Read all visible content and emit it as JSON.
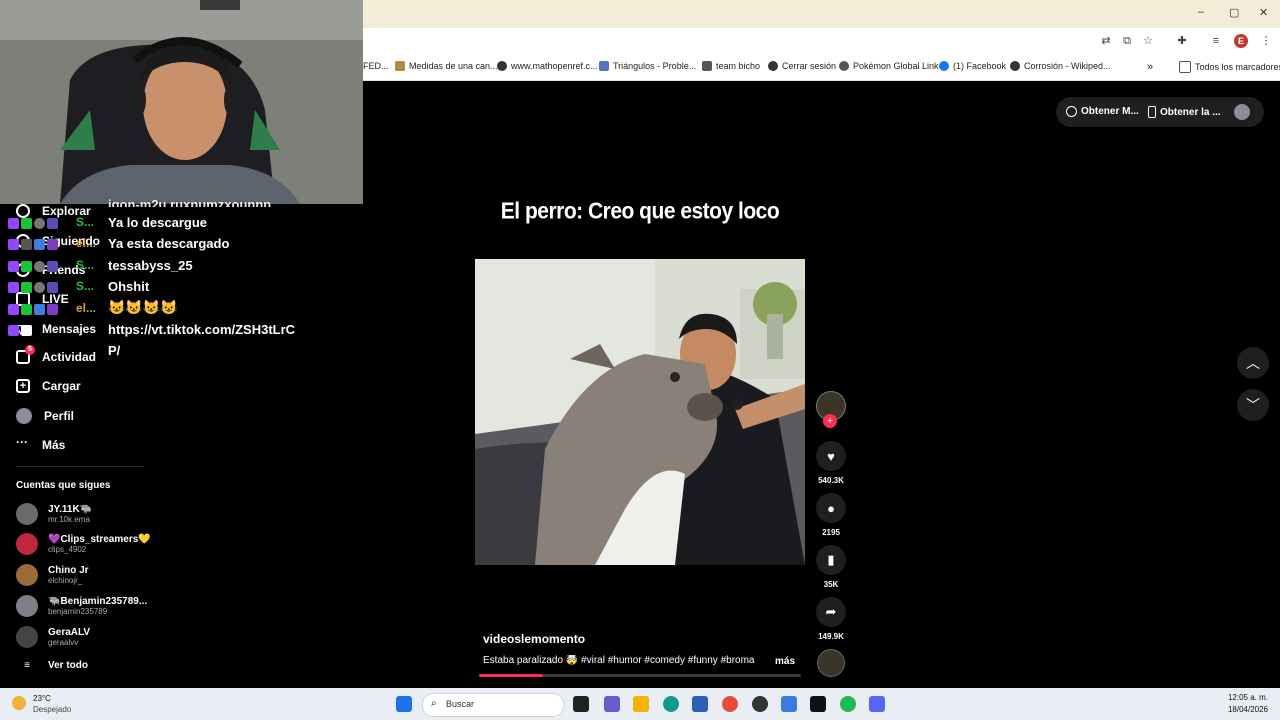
{
  "browser": {
    "window_controls": {
      "minimize": "–",
      "maximize": "▢",
      "close": "✕"
    },
    "profile_initial": "E",
    "bookmarks": [
      {
        "label": "FED...",
        "color": "#888888"
      },
      {
        "label": "Medidas de una can...",
        "color": "#b08a3c"
      },
      {
        "label": "www.mathopenref.c...",
        "color": "#333333"
      },
      {
        "label": "Triángulos - Proble...",
        "color": "#5b6ec7"
      },
      {
        "label": "team bicho",
        "color": "#555555"
      },
      {
        "label": "Cerrar sesión",
        "color": "#333333"
      },
      {
        "label": "Pokémon Global Link",
        "color": "#555555"
      },
      {
        "label": "(1) Facebook",
        "color": "#1877f2"
      },
      {
        "label": "Corrosión - Wikiped...",
        "color": "#333333"
      }
    ],
    "all_bookmarks": "Todos los marcadores"
  },
  "tiktok": {
    "top_buttons": {
      "get_coins": "Obtener M...",
      "get_app": "Obtener la ..."
    },
    "nav": [
      {
        "label": "Explorar"
      },
      {
        "label": "Siguiendo"
      },
      {
        "label": "Friends"
      },
      {
        "label": "LIVE"
      },
      {
        "label": "Mensajes"
      },
      {
        "label": "Actividad",
        "badge": "5"
      },
      {
        "label": "Cargar"
      },
      {
        "label": "Perfil"
      },
      {
        "label": "Más"
      }
    ],
    "following_title": "Cuentas que sigues",
    "following": [
      {
        "name": "JY.11K🐃",
        "user": "mr.10k.ema",
        "color": "#6b6b6b"
      },
      {
        "name": "💜Clips_streamers💛",
        "user": "clips_4902",
        "color": "#c0263f"
      },
      {
        "name": "Chino Jr",
        "user": "elchinojr_",
        "color": "#9a6a3a"
      },
      {
        "name": "🐃Benjamin235789...",
        "user": "benjamin235789",
        "color": "#7f7f8a"
      },
      {
        "name": "GeraALV",
        "user": "geraalvv",
        "color": "#444444"
      }
    ],
    "see_all": "Ver todo",
    "video": {
      "caption_top": "El perro: Creo que estoy loco",
      "author": "videoslemomento",
      "description": "Estaba paralizado 🤯 #viral #humor #comedy #funny #broma",
      "more": "más",
      "progress": 0.2
    },
    "actions": {
      "likes": "540.3K",
      "comments": "2195",
      "saves": "35K",
      "shares": "149.9K"
    }
  },
  "chat": {
    "partial_top": "igon-m2u ruxnumzxounnn",
    "lines": [
      {
        "user": "S...",
        "color": "#1ec03c",
        "text": "Ya lo descargue"
      },
      {
        "user": "el...",
        "color": "#c9a227",
        "text": "Ya esta descargado"
      },
      {
        "user": "S...",
        "color": "#1ec03c",
        "text": "tessabyss_25"
      },
      {
        "user": "S...",
        "color": "#1ec03c",
        "text": "Ohshit"
      },
      {
        "user": "el...",
        "color": "#c9a227",
        "text": "😺😺😺😺"
      }
    ],
    "link_line1": "https://vt.tiktok.com/ZSH3tLrC",
    "link_line2": "P/"
  },
  "taskbar": {
    "weather_temp": "23°C",
    "weather_desc": "Despejado",
    "search_placeholder": "Buscar",
    "time": "12:05 a. m.",
    "date": "18/04/2026"
  }
}
